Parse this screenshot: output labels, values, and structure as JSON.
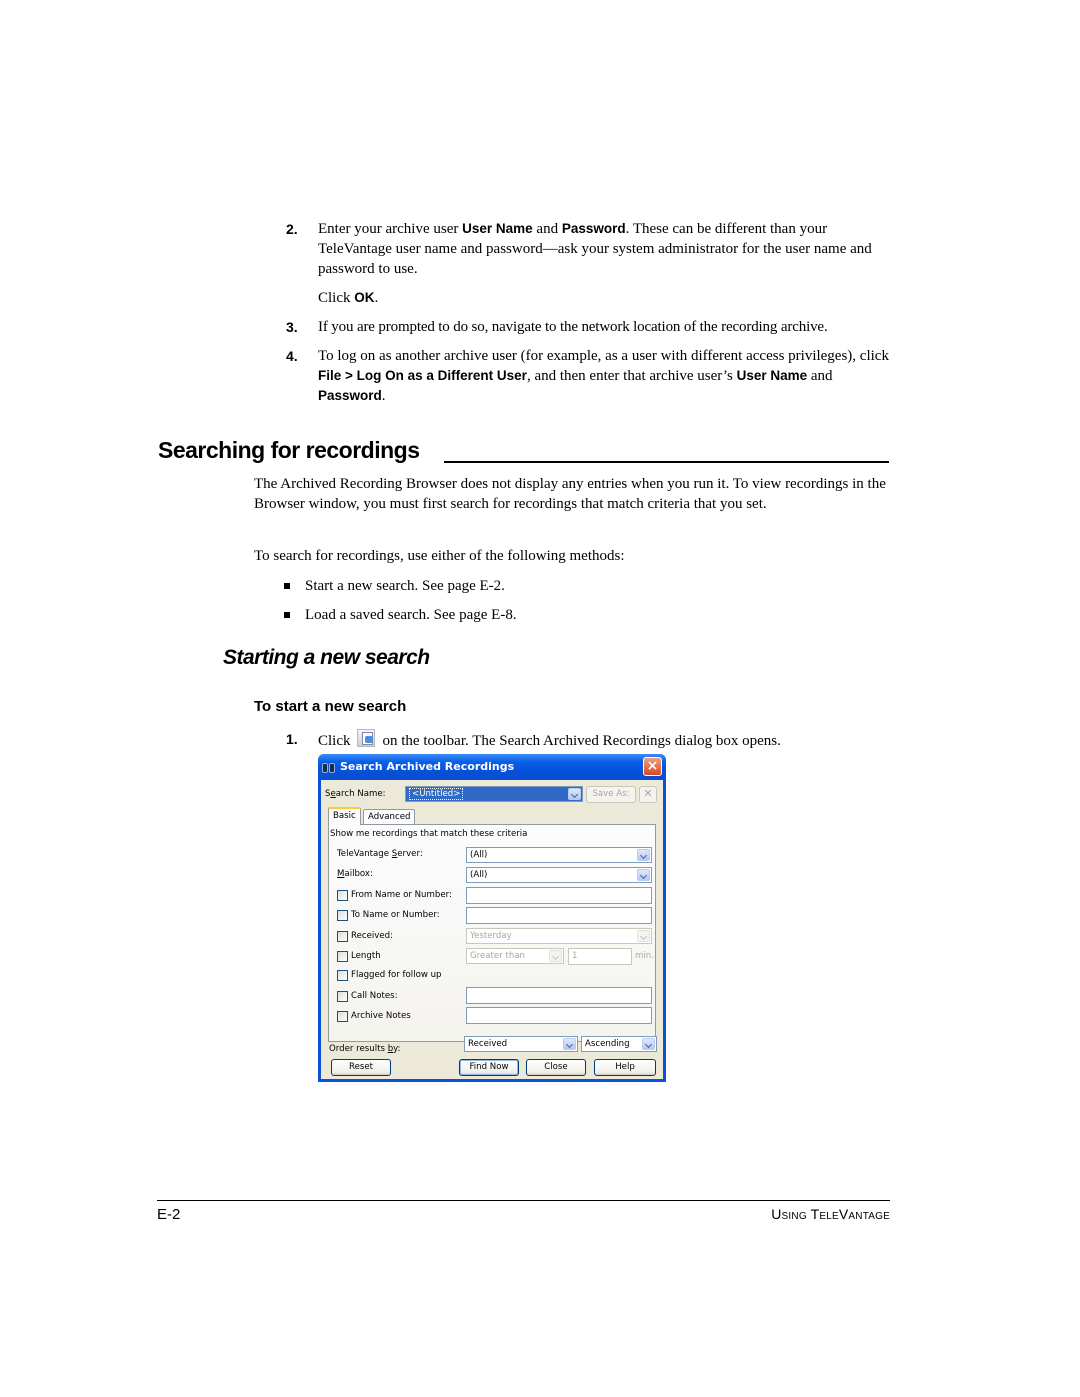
{
  "steps_top": [
    {
      "num": "2.",
      "parts": {
        "a": "Enter your archive user ",
        "b": "User Name",
        "c": " and ",
        "d": "Password",
        "e": ". These can be different than your TeleVantage user name and password—ask your system administrator for the user name and password to use."
      },
      "click_prefix": "Click ",
      "click_bold": "OK",
      "click_suffix": "."
    },
    {
      "num": "3.",
      "text": "If you are prompted to do so, navigate to the network location of the recording archive."
    },
    {
      "num": "4.",
      "parts": {
        "a": "To log on as another archive user (for example, as a user with different access privileges), click ",
        "b": "File > Log On as a Different User",
        "c": ", and then enter that archive user’s ",
        "d": "User Name",
        "e": " and ",
        "f": "Password",
        "g": "."
      }
    }
  ],
  "section": {
    "title": "Searching for recordings",
    "intro": "The Archived Recording Browser does not display any entries when you run it. To view recordings in the Browser window, you must first search for recordings that match criteria that you set.",
    "methods_intro": "To search for recordings, use either of the following methods:",
    "methods": [
      "Start a new search. See page E-2.",
      "Load a saved search. See page E-8."
    ]
  },
  "subsection": {
    "title": "Starting a new search",
    "procedure_title": "To start a new search",
    "step1": {
      "num": "1.",
      "prefix": "Click",
      "icon": "new-search-icon",
      "suffix": "on the toolbar. The Search Archived Recordings dialog box opens."
    }
  },
  "dialog": {
    "title": "Search Archived Recordings",
    "title_icon": "binoculars-icon",
    "search_name_label_pre": "S",
    "search_name_label_key": "e",
    "search_name_label_post": "arch Name:",
    "search_name_value": "<Untitled>",
    "save_as_label": "Save As:",
    "delete_label": "✕",
    "tabs": [
      "Basic",
      "Advanced"
    ],
    "active_tab": "Basic",
    "criteria_heading": "Show me recordings that match these criteria",
    "server_label_pre": "TeleVantage ",
    "server_label_key": "S",
    "server_label_post": "erver:",
    "server_value": "(All)",
    "mailbox_label_key": "M",
    "mailbox_label_post": "ailbox:",
    "mailbox_value": "(All)",
    "from_label": "From Name or Number:",
    "from_value": "",
    "to_label": "To Name or Number:",
    "to_value": "",
    "received_label": "Received:",
    "received_value": "Yesterday",
    "length_label": "Length",
    "length_op": "Greater than",
    "length_value": "1",
    "length_unit": "min.",
    "flagged_label": "Flagged for follow up",
    "call_notes_label": "Call Notes:",
    "call_notes_value": "",
    "archive_notes_label": "Archive Notes",
    "archive_notes_value": "",
    "order_label_pre": "Order results ",
    "order_label_key": "b",
    "order_label_post": "y:",
    "order_field": "Received",
    "order_dir": "Ascending",
    "buttons": {
      "reset": "Reset",
      "find_now": "Find Now",
      "close": "Close",
      "help": "Help"
    }
  },
  "footer": {
    "page": "E-2",
    "book": "Using TeleVantage"
  }
}
